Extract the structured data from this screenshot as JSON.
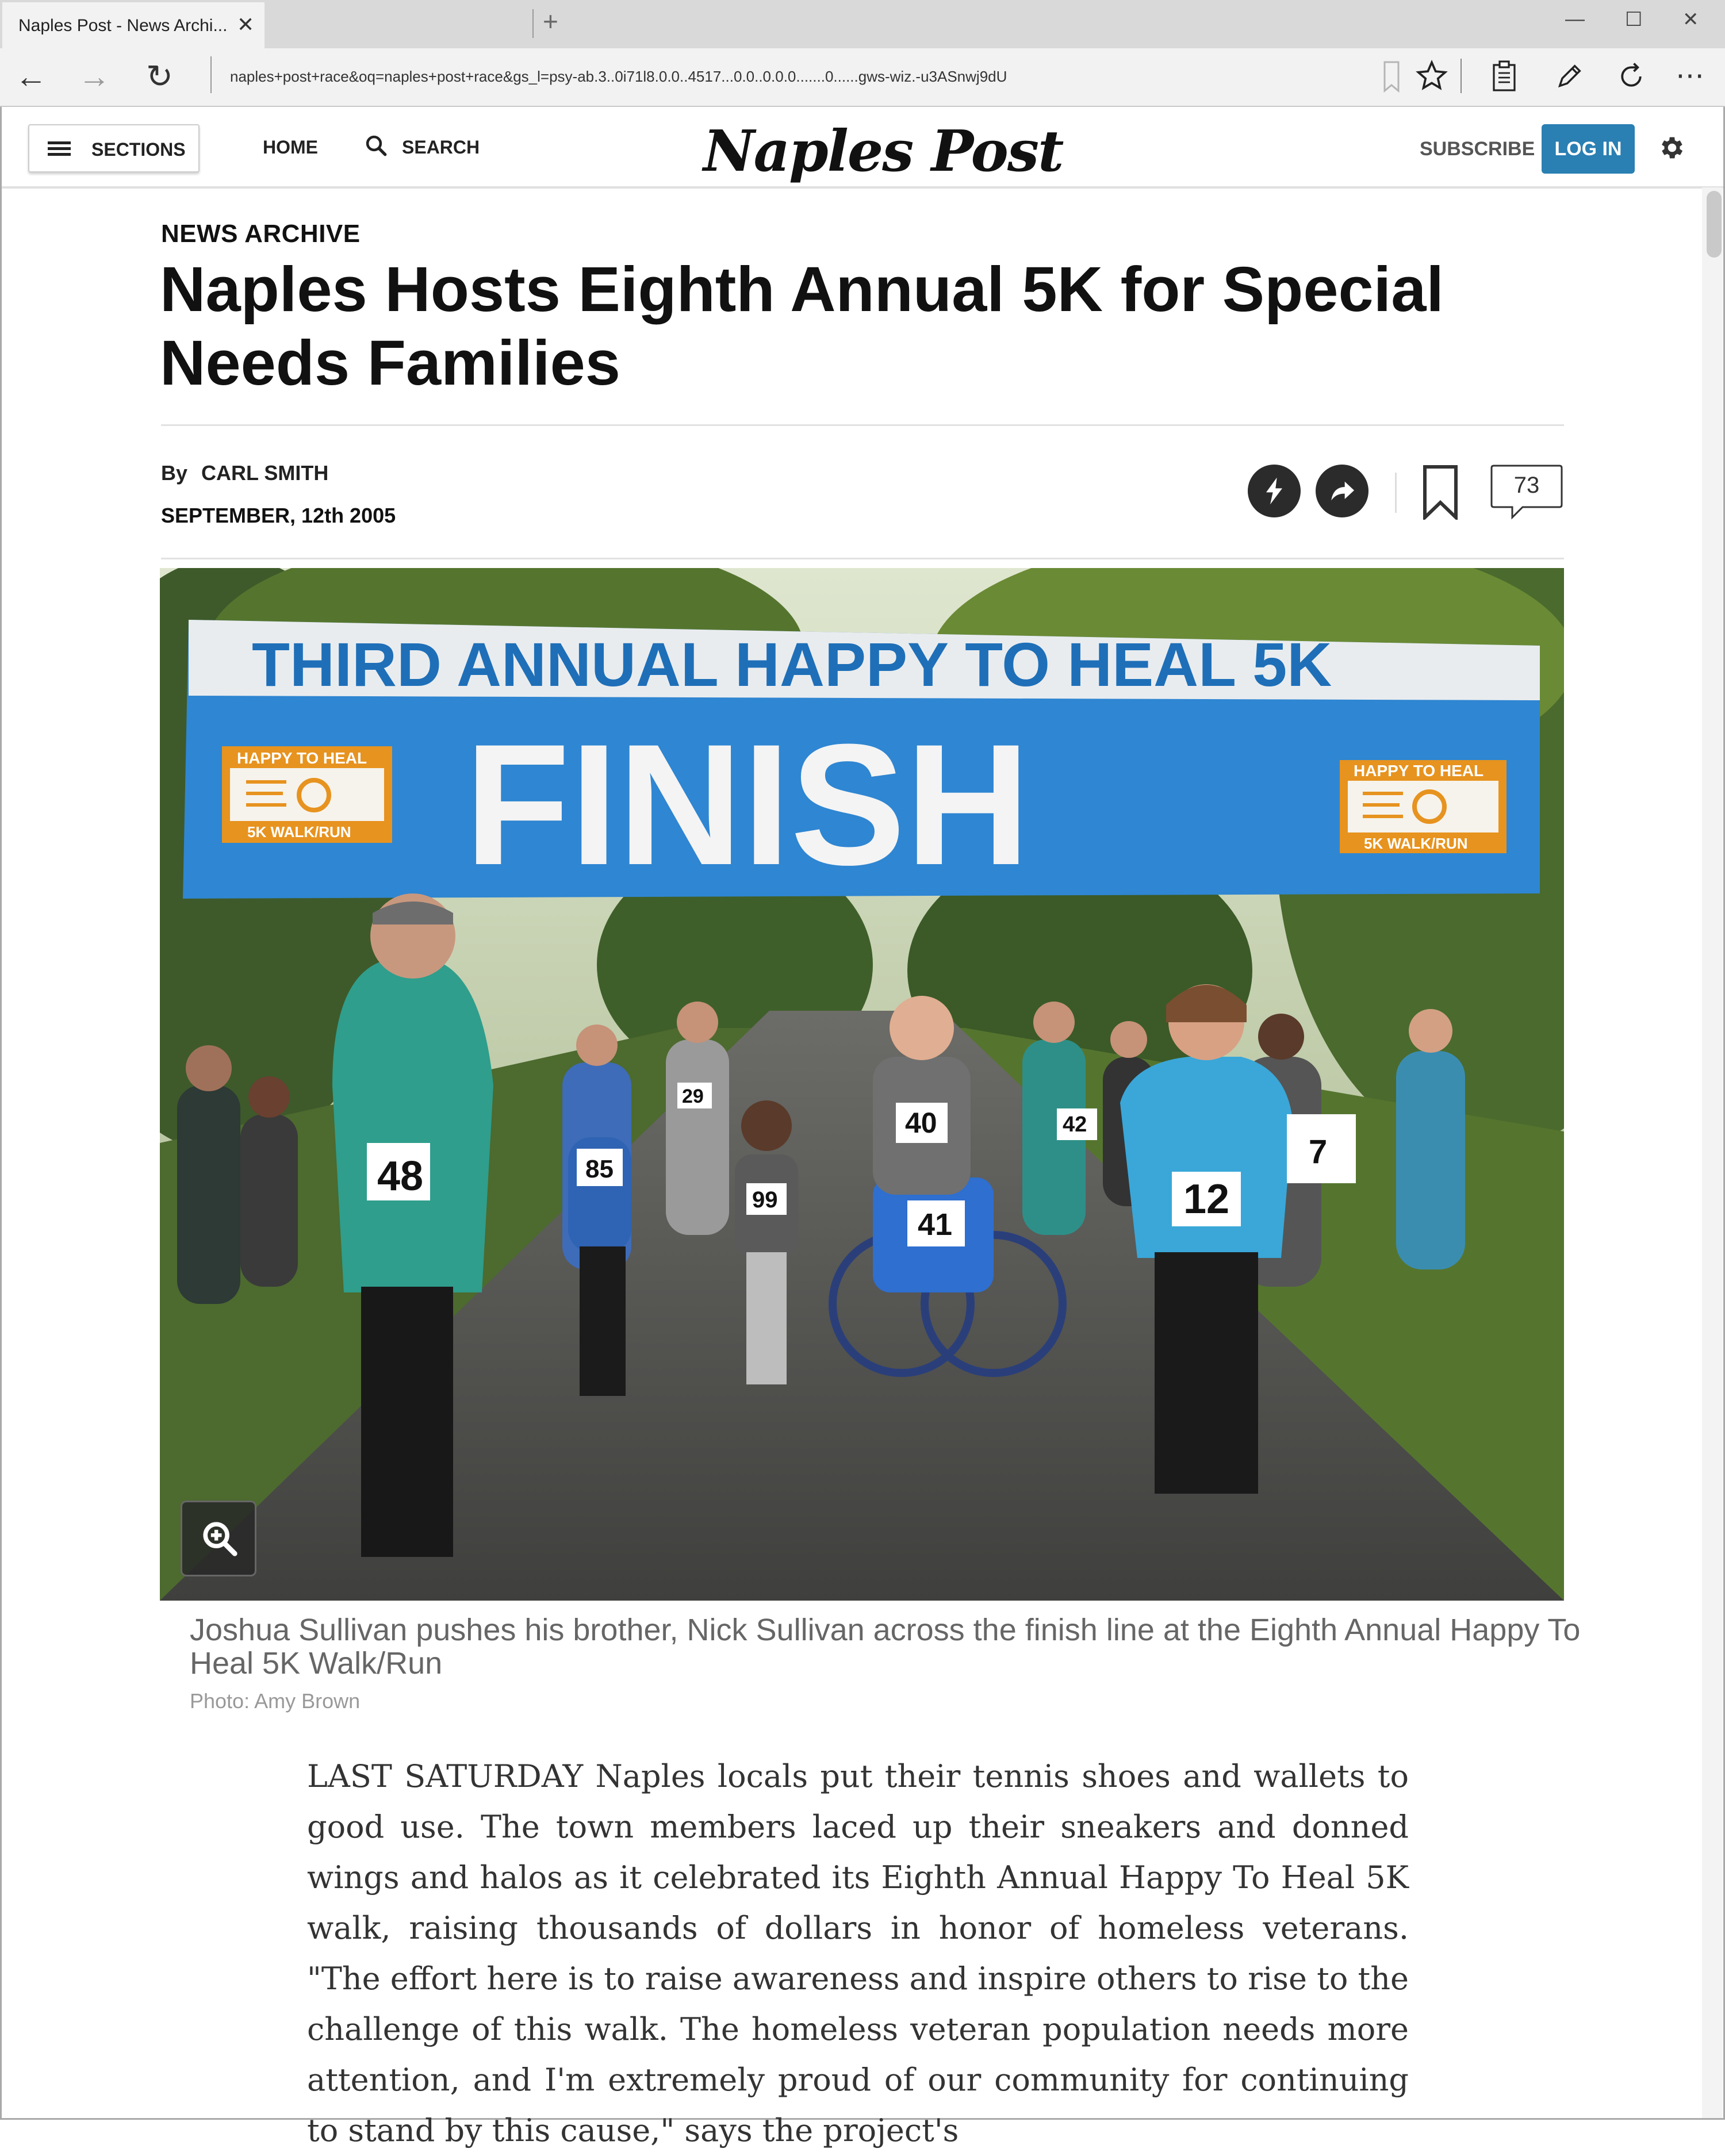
{
  "browser": {
    "tab_title": "Naples Post - News Archi...",
    "tab_close": "✕",
    "new_tab": "+",
    "url": "naples+post+race&oq=naples+post+race&gs_l=psy-ab.3..0i71l8.0.0..4517...0.0..0.0.0.......0......gws-wiz.-u3ASnwj9dU",
    "win_minimize": "—",
    "win_maximize": "☐",
    "win_close": "✕",
    "back": "←",
    "forward": "→",
    "refresh": "↻",
    "more": "⋯"
  },
  "header": {
    "sections_label": "SECTIONS",
    "home_label": "HOME",
    "search_label": "SEARCH",
    "masthead": "Naples Post",
    "subscribe_label": "SUBSCRIBE",
    "login_label": "LOG IN"
  },
  "article": {
    "kicker": "NEWS ARCHIVE",
    "headline": "Naples Hosts Eighth Annual 5K for Special Needs Families",
    "by_prefix": "By",
    "author": "CARL SMITH",
    "date": "SEPTEMBER, 12th 2005",
    "comment_count": "73",
    "photo": {
      "banner_top": "THIRD ANNUAL HAPPY TO HEAL 5K",
      "banner_main": "FINISH",
      "logo_top": "HAPPY TO HEAL",
      "logo_bottom": "5K WALK/RUN",
      "bibs": [
        "48",
        "85",
        "29",
        "99",
        "40",
        "41",
        "42",
        "12",
        "7"
      ]
    },
    "caption": "Joshua Sullivan pushes his brother, Nick Sullivan across the finish line at the Eighth Annual Happy To Heal 5K Walk/Run",
    "credit": "Photo: Amy Brown",
    "body": "LAST SATURDAY Naples locals put their tennis shoes and wallets to good use. The town members laced up their sneakers and donned wings and halos as it celebrated its Eighth Annual Happy To Heal 5K walk, raising thousands of dollars in honor of homeless veterans. \"The effort here is to raise awareness and inspire others to rise to the challenge of this walk. The homeless veteran population needs more attention, and I'm extremely proud of our community for continuing to stand by this cause,\" says the project's"
  },
  "colors": {
    "login_blue": "#2a7fb3",
    "banner_blue": "#2f86d2",
    "logo_orange": "#e7931f"
  }
}
